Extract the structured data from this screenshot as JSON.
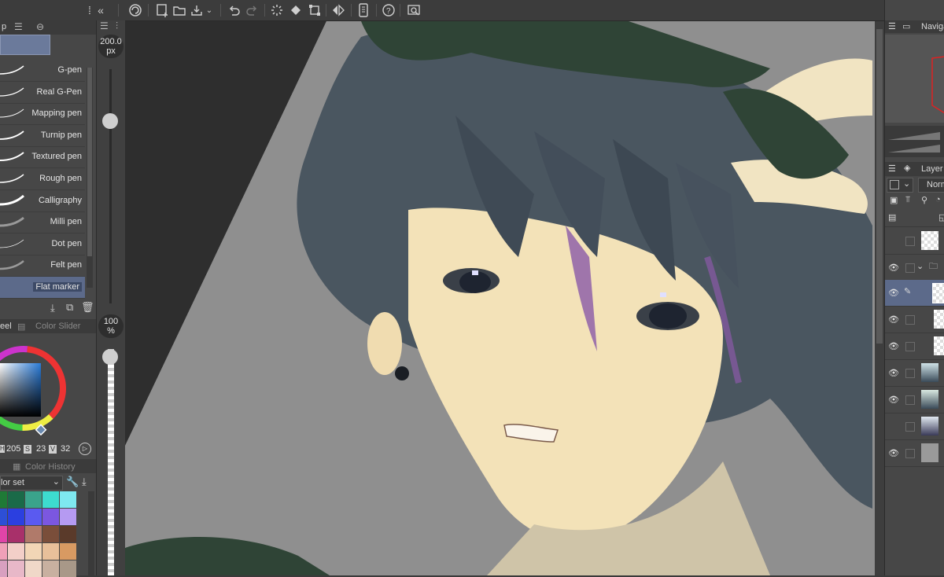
{
  "toolbar": {
    "icons": [
      "collapse-icon",
      "clip-studio-icon",
      "new-canvas-icon",
      "open-icon",
      "save-icon",
      "undo-icon",
      "redo-icon",
      "loading-icon",
      "fill-icon",
      "transform-icon",
      "flip-icon",
      "device-icon",
      "help-icon",
      "search-icon"
    ]
  },
  "brush_panel": {
    "tab_label": "p",
    "brushes": [
      {
        "label": "G-pen"
      },
      {
        "label": "Real G-Pen"
      },
      {
        "label": "Mapping pen"
      },
      {
        "label": "Turnip pen"
      },
      {
        "label": "Textured pen"
      },
      {
        "label": "Rough pen"
      },
      {
        "label": "Calligraphy"
      },
      {
        "label": "Milli pen"
      },
      {
        "label": "Dot pen"
      },
      {
        "label": "Felt pen"
      },
      {
        "label": "Flat marker"
      }
    ],
    "selected_index": 10
  },
  "size_panel": {
    "brush_size_value": "200.0",
    "brush_size_unit": "px",
    "opacity_value": "100",
    "opacity_unit": "%",
    "size_slider_level": 0.22,
    "opacity_slider_level": 0.0
  },
  "color_panel": {
    "tab_wheel": "eel",
    "tab_slider": "Color Slider",
    "h_value": "205",
    "s_label": "S",
    "s_value": "23",
    "v_label": "V",
    "v_value": "32",
    "h_label": "H",
    "history_tab": "Color History",
    "color_set_label": "lor set",
    "swatches": [
      "#1f7a36",
      "#1a6a48",
      "#3aa38b",
      "#3ddccf",
      "#7ee8f0",
      "#2d4fd6",
      "#2b3fe0",
      "#5a5af0",
      "#7b57e0",
      "#b59af2",
      "#e044a8",
      "#a8306a",
      "#b07a6a",
      "#7a4e3a",
      "#5a3a2a",
      "#f0a0b8",
      "#f3cfc8",
      "#f2d6b6",
      "#e8c09a",
      "#d89a62",
      "#d8a0c0",
      "#e8b8c8",
      "#f0d8c8",
      "#c8b0a0",
      "#a89888"
    ]
  },
  "right_panel": {
    "navigator_label": "Naviga",
    "layer_label": "Layer",
    "blend_mode_label": "Norm"
  },
  "colors": {
    "accent_selected": "#5c6a8a",
    "canvas_bg": "#8f8f8f"
  }
}
